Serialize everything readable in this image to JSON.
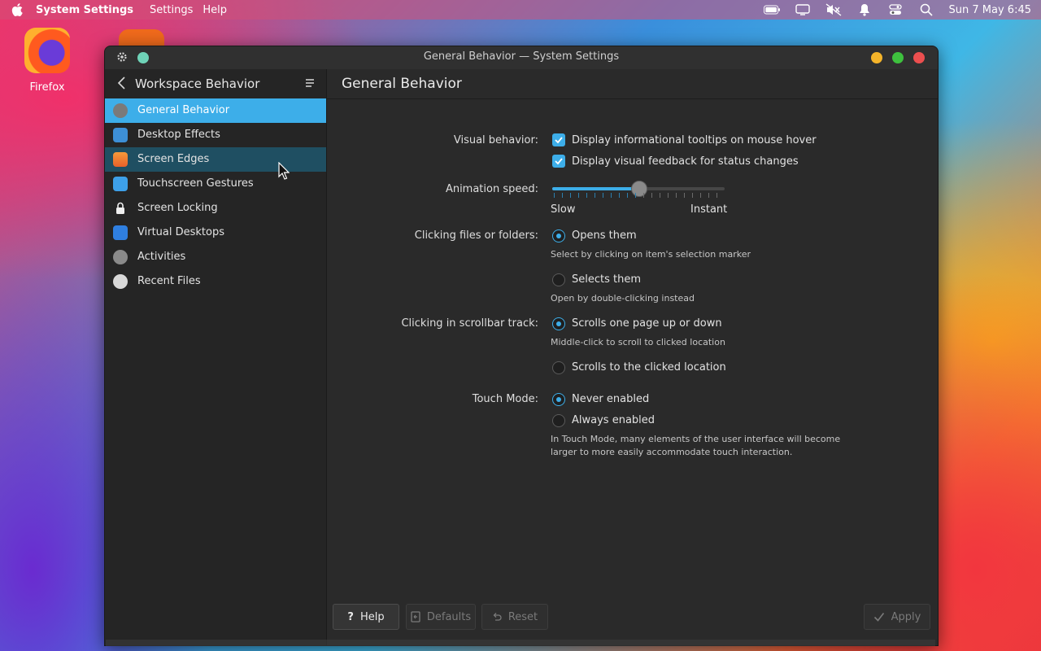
{
  "menubar": {
    "app_name": "System Settings",
    "menus": [
      "Settings",
      "Help"
    ],
    "clock": "Sun 7 May 6:45"
  },
  "desktop": {
    "icons": [
      {
        "label": "Firefox"
      }
    ]
  },
  "window": {
    "title": "General Behavior — System Settings"
  },
  "sidebar": {
    "header": "Workspace Behavior",
    "items": [
      {
        "label": "General Behavior",
        "icon": "gear-icon",
        "color": "#7a7a7a"
      },
      {
        "label": "Desktop Effects",
        "icon": "effects-icon",
        "color": "#3d8fd6"
      },
      {
        "label": "Screen Edges",
        "icon": "screen-edges-icon",
        "color": "#f0853a"
      },
      {
        "label": "Touchscreen Gestures",
        "icon": "touch-icon",
        "color": "#3da0e9"
      },
      {
        "label": "Screen Locking",
        "icon": "lock-icon",
        "color": "#e6e6e6"
      },
      {
        "label": "Virtual Desktops",
        "icon": "virtual-desktops-icon",
        "color": "#2f7fe0"
      },
      {
        "label": "Activities",
        "icon": "activities-icon",
        "color": "#8a8a8a"
      },
      {
        "label": "Recent Files",
        "icon": "clock-icon",
        "color": "#d8d8d8"
      }
    ]
  },
  "main": {
    "title": "General Behavior",
    "visual_behavior": {
      "label": "Visual behavior:",
      "option1": "Display informational tooltips on mouse hover",
      "option2": "Display visual feedback for status changes",
      "option1_checked": true,
      "option2_checked": true
    },
    "animation": {
      "label": "Animation speed:",
      "min_label": "Slow",
      "max_label": "Instant",
      "value": 0.5
    },
    "clicking_files": {
      "label": "Clicking files or folders:",
      "opt1": "Opens them",
      "hint1": "Select by clicking on item's selection marker",
      "opt2": "Selects them",
      "hint2": "Open by double-clicking instead",
      "selected": 0
    },
    "scrollbar": {
      "label": "Clicking in scrollbar track:",
      "opt1": "Scrolls one page up or down",
      "hint1": "Middle-click to scroll to clicked location",
      "opt2": "Scrolls to the clicked location",
      "selected": 0
    },
    "touch": {
      "label": "Touch Mode:",
      "opt1": "Never enabled",
      "opt2": "Always enabled",
      "hint_line1": "In Touch Mode, many elements of the user interface will become",
      "hint_line2": "larger to more easily accommodate touch interaction.",
      "selected": 0
    }
  },
  "buttons": {
    "help": "Help",
    "defaults": "Defaults",
    "reset": "Reset",
    "apply": "Apply"
  },
  "colors": {
    "accent": "#3daee9",
    "minimize": "#f5b42a",
    "maximize": "#3ec13e",
    "close": "#ec4f4f"
  }
}
